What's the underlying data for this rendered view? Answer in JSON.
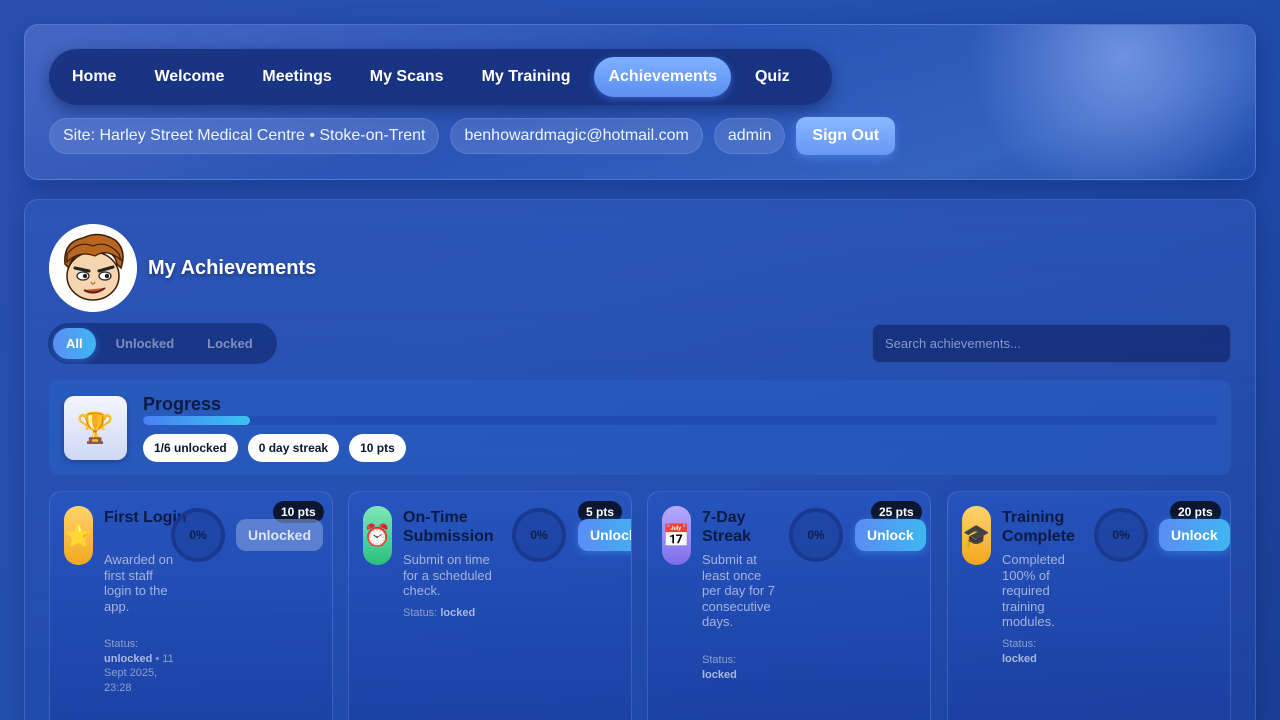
{
  "nav": {
    "items": [
      {
        "label": "Home"
      },
      {
        "label": "Welcome"
      },
      {
        "label": "Meetings"
      },
      {
        "label": "My Scans"
      },
      {
        "label": "My Training"
      },
      {
        "label": "Achievements"
      },
      {
        "label": "Quiz"
      }
    ],
    "active": "Achievements"
  },
  "user_bar": {
    "site": "Site: Harley Street Medical Centre • Stoke-on-Trent",
    "email": "benhowardmagic@hotmail.com",
    "role": "admin",
    "sign_out": "Sign Out"
  },
  "page": {
    "title": "My Achievements"
  },
  "filters": {
    "items": [
      "All",
      "Unlocked",
      "Locked"
    ],
    "active": "All"
  },
  "search": {
    "placeholder": "Search achievements..."
  },
  "progress": {
    "title": "Progress",
    "fraction": 0.1667,
    "stats": [
      "1/6 unlocked",
      "0 day streak",
      "10 pts"
    ]
  },
  "achievements": [
    {
      "icon": "star-icon",
      "icon_glyph": "⭐",
      "icon_color": "#f7b733",
      "title": "First Login",
      "description": "Awarded on first staff login to the app.",
      "status_label": "Status:",
      "status": "unlocked",
      "status_extra": "• 11 Sept 2025, 23:28",
      "progress": "0%",
      "points": "10 pts",
      "button": "Unlocked"
    },
    {
      "icon": "alarm-clock-icon",
      "icon_glyph": "⏰",
      "icon_color": "#3ecf8e",
      "title": "On-Time Submission",
      "description": "Submit on time for a scheduled check.",
      "status_label": "Status:",
      "status": "locked",
      "status_extra": "",
      "progress": "0%",
      "points": "5 pts",
      "button": "Unlock"
    },
    {
      "icon": "calendar-icon",
      "icon_glyph": "📅",
      "icon_color": "#9a8cf0",
      "title": "7-Day Streak",
      "description": "Submit at least once per day for 7 consecutive days.",
      "status_label": "Status:",
      "status": "locked",
      "status_extra": "",
      "progress": "0%",
      "points": "25 pts",
      "button": "Unlock"
    },
    {
      "icon": "graduation-cap-icon",
      "icon_glyph": "🎓",
      "icon_color": "#f7b733",
      "title": "Training Complete",
      "description": "Completed 100% of required training modules.",
      "status_label": "Status:",
      "status": "locked",
      "status_extra": "",
      "progress": "0%",
      "points": "20 pts",
      "button": "Unlock"
    }
  ]
}
